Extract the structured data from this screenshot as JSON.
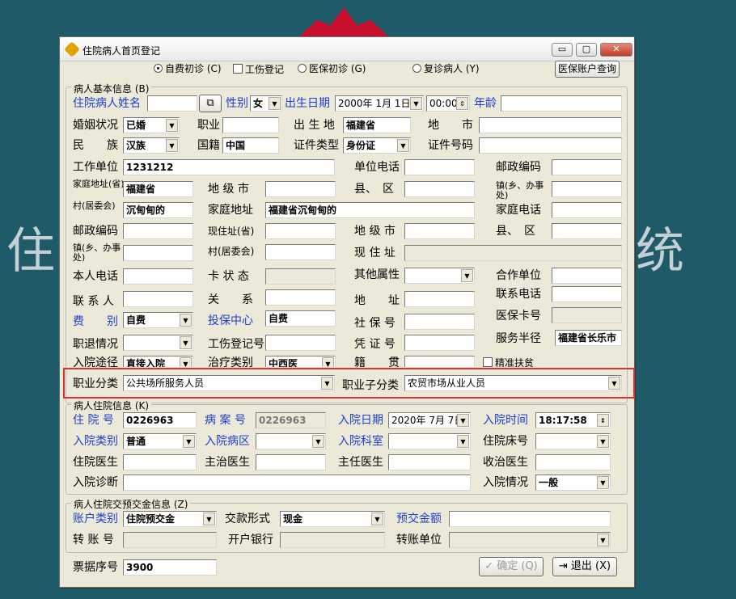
{
  "background": {
    "left_text": "住",
    "right_text": "统"
  },
  "window": {
    "title": "住院病人首页登记",
    "min": "▭",
    "max": "▢",
    "close": "✕"
  },
  "top": {
    "radio1": "自费初诊 (C)",
    "check1": "工伤登记",
    "radio2": "医保初诊 (G)",
    "radio3": "复诊病人 (Y)",
    "acct_btn": "医保账户查询"
  },
  "basic": {
    "group": "病人基本信息 (B)",
    "name_label": "住院病人姓名",
    "name": "",
    "sex_label": "性别",
    "sex": "女",
    "birth_label": "出生日期",
    "birth_date": "2000年 1月 1日",
    "birth_time": "00:00",
    "age_label": "年龄",
    "age": "",
    "marital_label": "婚姻状况",
    "marital": "已婚",
    "job_label": "职业",
    "job": "",
    "birthplace_label": "出 生 地",
    "birthplace": "福建省",
    "city_label": "地　　市",
    "city": "",
    "nation_label": "民　　族",
    "nation": "汉族",
    "nationality_label": "国籍",
    "nationality": "中国",
    "idtype_label": "证件类型",
    "idtype": "身份证",
    "idno_label": "证件号码",
    "idno": "",
    "work_label": "工作单位",
    "work": "1231212",
    "workphone_label": "单位电话",
    "workphone": "",
    "postcode_label": "邮政编码",
    "postcode": "",
    "homeprov_label": "家庭地址(省)",
    "homeprov": "福建省",
    "citylevel_label": "地 级 市",
    "citylevel": "",
    "county_label": "县、　区",
    "county": "",
    "town_label": "镇(乡、办事处)",
    "town": "",
    "village_label": "村(居委会)",
    "village": "沉甸甸的",
    "homeaddr_label": "家庭地址",
    "homeaddr": "福建省沉甸甸的",
    "homephone_label": "家庭电话",
    "homephone": "",
    "postcode2_label": "邮政编码",
    "postcode2": "",
    "curprov_label": "现住址(省)",
    "curprov": "",
    "curcity_label": "地 级 市",
    "curcity": "",
    "curcounty_label": "县、　区",
    "curcounty": "",
    "curtown_label": "镇(乡、办事处)",
    "curtown": "",
    "curvillage_label": "村(居委会)",
    "curvillage": "",
    "curaddr_label": "现 住 址",
    "curaddr": "",
    "selfphone_label": "本人电话",
    "selfphone": "",
    "card_label": "卡 状 态",
    "card": "",
    "other_label": "其他属性",
    "other": "",
    "coop_label": "合作单位",
    "coop": "",
    "contact_label": "联 系 人",
    "contact": "",
    "relation_label": "关　　系",
    "relation": "",
    "contactphone_label": "联系电话",
    "contactphone": "",
    "address_label": "地　　址",
    "address": "",
    "insurecard_label": "医保卡号",
    "insurecard": "",
    "fee_label": "费　　别",
    "fee": "自费",
    "insurecenter_label": "投保中心",
    "insurecenter": "自费",
    "socialno_label": "社 保 号",
    "socialno": "",
    "retire_label": "职退情况",
    "retire": "",
    "injury_label": "工伤登记号",
    "injury": "",
    "voucher_label": "凭 证 号",
    "voucher": "",
    "radius_label": "服务半径",
    "radius": "福建省长乐市",
    "admitway_label": "入院途径",
    "admitway": "直接入院",
    "treat_label": "治疗类别",
    "treat": "中西医",
    "origin_label": "籍　　贯",
    "origin": "",
    "poverty": "精准扶贫",
    "occ_label": "职业分类",
    "occ": "公共场所服务人员",
    "suboc_label": "职业子分类",
    "suboc": "农贸市场从业人员"
  },
  "hosp": {
    "group": "病人住院信息 (K)",
    "inno_label": "住 院 号",
    "inno": "0226963",
    "caseno_label": "病 案 号",
    "caseno": "0226963",
    "indate_label": "入院日期",
    "indate": "2020年 7月 7日",
    "intime_label": "入院时间",
    "intime": "18:17:58",
    "intype_label": "入院类别",
    "intype": "普通",
    "ward_label": "入院病区",
    "ward": "",
    "dept_label": "入院科室",
    "dept": "",
    "bed_label": "住院床号",
    "bed": "",
    "doctor_label": "住院医生",
    "doctor": "",
    "attend_label": "主治医生",
    "attend": "",
    "chief_label": "主任医生",
    "chief": "",
    "admit_label": "收治医生",
    "admit": "",
    "diag_label": "入院诊断",
    "diag": "",
    "status_label": "入院情况",
    "status": "一般"
  },
  "deposit": {
    "group": "病人住院交预交金信息 (Z)",
    "acct_label": "账户类别",
    "acct": "住院预交金",
    "paymode_label": "交款形式",
    "paymode": "现金",
    "amount_label": "预交金额",
    "amount": "",
    "transfer_label": "转 账 号",
    "transfer": "",
    "bank_label": "开户银行",
    "bank": "",
    "unit_label": "转账单位",
    "unit": ""
  },
  "footer": {
    "receipt_label": "票据序号",
    "receipt": "3900",
    "ok": "确定 (Q)",
    "exit": "退出 (X)"
  }
}
